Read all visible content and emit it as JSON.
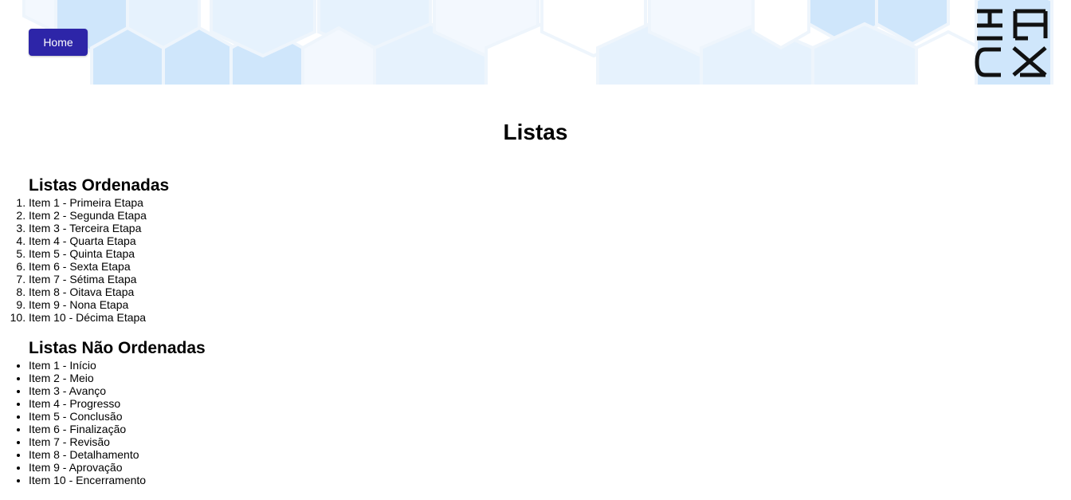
{
  "header": {
    "home_label": "Home",
    "logo_name": "ebac-logo-icon",
    "hex_colors": [
      "#cfe6fb",
      "#e6f2fd",
      "#f3f8fe"
    ]
  },
  "page": {
    "title": "Listas"
  },
  "ordered": {
    "heading": "Listas Ordenadas",
    "items": [
      "Item 1 - Primeira Etapa",
      "Item 2 - Segunda Etapa",
      "Item 3 - Terceira Etapa",
      "Item 4 - Quarta Etapa",
      "Item 5 - Quinta Etapa",
      "Item 6 - Sexta Etapa",
      "Item 7 - Sétima Etapa",
      "Item 8 - Oitava Etapa",
      "Item 9 - Nona Etapa",
      "Item 10 - Décima Etapa"
    ]
  },
  "unordered": {
    "heading": "Listas Não Ordenadas",
    "items": [
      "Item 1 - Início",
      "Item 2 - Meio",
      "Item 3 - Avanço",
      "Item 4 - Progresso",
      "Item 5 - Conclusão",
      "Item 6 - Finalização",
      "Item 7 - Revisão",
      "Item 8 - Detalhamento",
      "Item 9 - Aprovação",
      "Item 10 - Encerramento"
    ]
  },
  "colors": {
    "button_bg": "#2d25a8",
    "button_text": "#ffffff",
    "text": "#000000"
  }
}
